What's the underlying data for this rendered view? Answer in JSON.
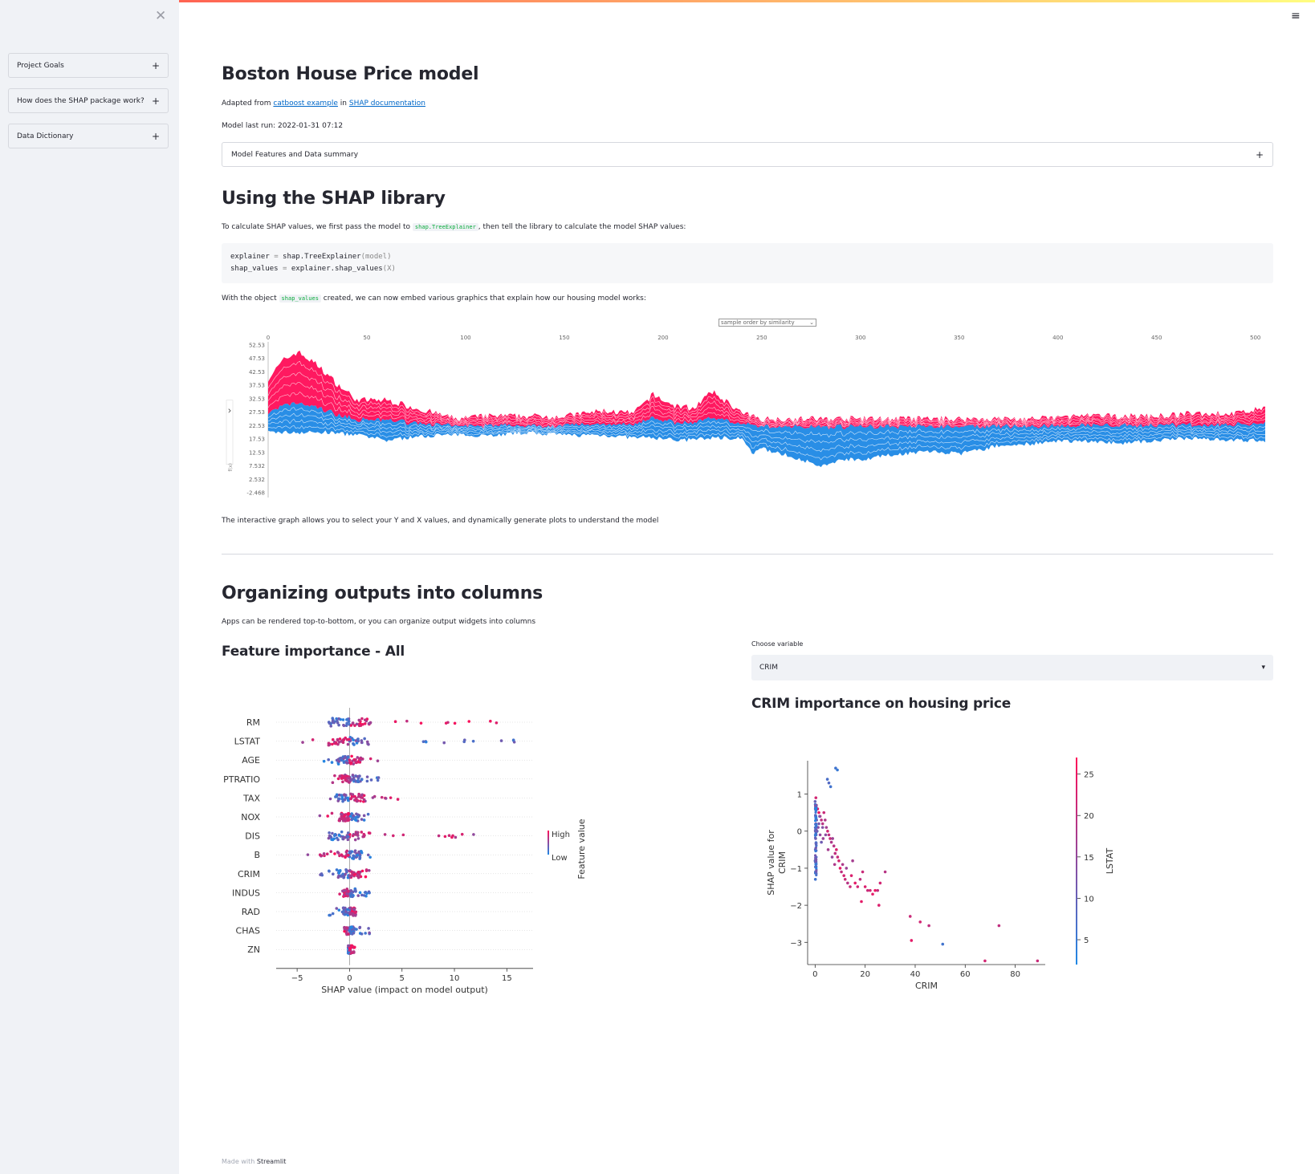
{
  "sidebar": {
    "close_icon": "close-icon",
    "items": [
      {
        "label": "Project Goals",
        "icon": "+"
      },
      {
        "label": "How does the SHAP package work?",
        "icon": "+"
      },
      {
        "label": "Data Dictionary",
        "icon": "+"
      }
    ]
  },
  "menu_icon": "≡",
  "page": {
    "title": "Boston House Price model",
    "adapted_prefix": "Adapted from ",
    "link1": "catboost example",
    "adapted_mid": " in ",
    "link2": "SHAP documentation",
    "last_run": "Model last run: 2022-01-31 07:12",
    "expander_label": "Model Features and Data summary",
    "expander_icon": "+"
  },
  "shap_section": {
    "heading": "Using the SHAP library",
    "intro_before": "To calculate SHAP values, we first pass the model to",
    "intro_code": "shap.TreeExplainer",
    "intro_after": ", then tell the library to calculate the model SHAP values:",
    "code": {
      "line1_a": "explainer",
      "line1_op": " = ",
      "line1_b": "shap.TreeExplainer",
      "line1_c": "(model)",
      "line2_a": "shap_values",
      "line2_op": " = ",
      "line2_b": "explainer.shap_values",
      "line2_c": "(X)"
    },
    "embed_before": "With the object",
    "embed_code": "shap_values",
    "embed_after": "created, we can now embed various graphics that explain how our housing model works:",
    "force_select": "sample order by similarity",
    "force_caption": "The interactive graph allows you to select your Y and X values, and dynamically generate plots to understand the model"
  },
  "columns_section": {
    "heading": "Organizing outputs into columns",
    "subtitle": "Apps can be rendered top-to-bottom, or you can organize output widgets into columns",
    "left_heading": "Feature importance - All",
    "select_label": "Choose variable",
    "select_value": "CRIM",
    "right_heading": "CRIM importance on housing price"
  },
  "footer": {
    "prefix": "Made with ",
    "brand": "Streamlit"
  },
  "colors": {
    "high": "#ff0d57",
    "low": "#1e88e5",
    "accent": "#ff4b4b",
    "link": "#0068c9"
  },
  "chart_data": [
    {
      "type": "area",
      "kind": "shap-force-plot",
      "x_ticks": [
        0,
        50,
        100,
        150,
        200,
        250,
        300,
        350,
        400,
        450,
        500
      ],
      "y_ticks": [
        52.53,
        47.53,
        42.53,
        37.53,
        32.53,
        27.53,
        22.53,
        17.53,
        12.53,
        7.532,
        2.532,
        -2.468
      ],
      "y_tick_labels": [
        "52.53",
        "47.53",
        "42.53",
        "37.53",
        "32.53",
        "27.53",
        "22.53",
        "17.53",
        "12.53",
        "7.532",
        "2.532",
        "-2.468"
      ],
      "xlim": [
        0,
        505
      ],
      "ylim": [
        -2.468,
        52.53
      ],
      "base_value": 22.53,
      "y_label": "f(x)",
      "upper": [
        [
          0,
          40
        ],
        [
          8,
          47
        ],
        [
          15,
          50
        ],
        [
          25,
          45
        ],
        [
          35,
          38
        ],
        [
          45,
          32
        ],
        [
          60,
          32
        ],
        [
          75,
          29
        ],
        [
          85,
          27
        ],
        [
          95,
          25
        ],
        [
          110,
          26
        ],
        [
          130,
          26
        ],
        [
          150,
          26
        ],
        [
          170,
          28
        ],
        [
          185,
          27
        ],
        [
          195,
          34
        ],
        [
          205,
          30
        ],
        [
          215,
          29
        ],
        [
          225,
          35
        ],
        [
          235,
          30
        ],
        [
          240,
          27
        ],
        [
          250,
          25
        ],
        [
          275,
          25
        ],
        [
          290,
          25
        ],
        [
          310,
          25
        ],
        [
          330,
          25
        ],
        [
          350,
          25
        ],
        [
          370,
          25
        ],
        [
          390,
          25
        ],
        [
          410,
          26
        ],
        [
          430,
          26
        ],
        [
          450,
          26
        ],
        [
          470,
          27
        ],
        [
          490,
          27
        ],
        [
          505,
          29
        ]
      ],
      "lower": [
        [
          0,
          20
        ],
        [
          15,
          20
        ],
        [
          30,
          20
        ],
        [
          45,
          19
        ],
        [
          60,
          17
        ],
        [
          70,
          18
        ],
        [
          85,
          19
        ],
        [
          100,
          19
        ],
        [
          115,
          19
        ],
        [
          130,
          20
        ],
        [
          150,
          19
        ],
        [
          170,
          19
        ],
        [
          185,
          18
        ],
        [
          195,
          18
        ],
        [
          210,
          17
        ],
        [
          225,
          18
        ],
        [
          240,
          18
        ],
        [
          245,
          12
        ],
        [
          250,
          14
        ],
        [
          260,
          12
        ],
        [
          270,
          10
        ],
        [
          280,
          7
        ],
        [
          290,
          10
        ],
        [
          300,
          10
        ],
        [
          310,
          11
        ],
        [
          320,
          12
        ],
        [
          335,
          13
        ],
        [
          350,
          12
        ],
        [
          370,
          15
        ],
        [
          390,
          16
        ],
        [
          410,
          17
        ],
        [
          430,
          16
        ],
        [
          450,
          17
        ],
        [
          470,
          18
        ],
        [
          490,
          17
        ],
        [
          505,
          17
        ]
      ]
    },
    {
      "type": "scatter",
      "kind": "shap-beeswarm",
      "features": [
        "RM",
        "LSTAT",
        "AGE",
        "PTRATIO",
        "TAX",
        "NOX",
        "DIS",
        "B",
        "CRIM",
        "INDUS",
        "RAD",
        "CHAS",
        "ZN"
      ],
      "spread": [
        [
          -4,
          16
        ],
        [
          -6,
          16.5
        ],
        [
          -2.5,
          3
        ],
        [
          -1.8,
          3.5
        ],
        [
          -2,
          5
        ],
        [
          -3,
          2
        ],
        [
          -1.5,
          12
        ],
        [
          -4,
          2
        ],
        [
          -3.5,
          2
        ],
        [
          -1,
          2
        ],
        [
          -2,
          1
        ],
        [
          -0.5,
          2
        ],
        [
          -0.2,
          0.5
        ]
      ],
      "x_ticks": [
        -5,
        0,
        5,
        10,
        15
      ],
      "xlim": [
        -7,
        17.5
      ],
      "xlabel": "SHAP value (impact on model output)",
      "colorbar_label": "Feature value",
      "colorbar_high": "High",
      "colorbar_low": "Low"
    },
    {
      "type": "scatter",
      "kind": "shap-dependence",
      "x_ticks": [
        0,
        20,
        40,
        60,
        80
      ],
      "y_ticks": [
        1,
        0,
        -1,
        -2,
        -3
      ],
      "xlim": [
        -3,
        92
      ],
      "ylim": [
        -3.6,
        1.9
      ],
      "xlabel": "CRIM",
      "ylabel_line1": "SHAP value for",
      "ylabel_line2": "CRIM",
      "colorbar_label": "LSTAT",
      "colorbar_ticks": [
        25,
        20,
        15,
        10,
        5
      ],
      "colorbar_range": [
        2,
        27
      ],
      "points": [
        [
          8.2,
          1.7,
          6
        ],
        [
          8.9,
          1.65,
          5
        ],
        [
          4.9,
          1.4,
          7
        ],
        [
          5.5,
          1.3,
          8
        ],
        [
          6.2,
          1.2,
          6
        ],
        [
          0.0,
          0.8,
          10
        ],
        [
          0.1,
          0.6,
          12
        ],
        [
          0.2,
          0.4,
          15
        ],
        [
          0.3,
          0.2,
          18
        ],
        [
          0.1,
          0.0,
          14
        ],
        [
          0.2,
          -0.2,
          12
        ],
        [
          0.1,
          -0.5,
          9
        ],
        [
          0.0,
          -0.8,
          8
        ],
        [
          0.1,
          -1.3,
          6
        ],
        [
          0.3,
          0.9,
          22
        ],
        [
          0.5,
          0.7,
          20
        ],
        [
          1.0,
          0.6,
          24
        ],
        [
          1.5,
          0.5,
          25
        ],
        [
          2.0,
          0.4,
          23
        ],
        [
          2.5,
          0.3,
          20
        ],
        [
          3.0,
          0.2,
          19
        ],
        [
          3.5,
          0.5,
          21
        ],
        [
          4.0,
          0.3,
          18
        ],
        [
          4.5,
          0.1,
          17
        ],
        [
          5.0,
          0.0,
          22
        ],
        [
          5.5,
          -0.1,
          20
        ],
        [
          6.0,
          -0.2,
          21
        ],
        [
          6.5,
          -0.3,
          18
        ],
        [
          7.0,
          -0.2,
          16
        ],
        [
          7.5,
          -0.4,
          19
        ],
        [
          8.0,
          -0.6,
          20
        ],
        [
          8.5,
          -0.5,
          23
        ],
        [
          9.0,
          -0.7,
          21
        ],
        [
          9.5,
          -0.8,
          22
        ],
        [
          10.0,
          -1.0,
          24
        ],
        [
          10.5,
          -1.1,
          20
        ],
        [
          11.0,
          -0.9,
          18
        ],
        [
          11.5,
          -1.2,
          22
        ],
        [
          12.0,
          -1.3,
          21
        ],
        [
          12.5,
          -1.0,
          16
        ],
        [
          13.0,
          -1.4,
          19
        ],
        [
          14.0,
          -1.5,
          21
        ],
        [
          14.5,
          -1.2,
          23
        ],
        [
          15.0,
          -0.8,
          17
        ],
        [
          16.0,
          -1.4,
          24
        ],
        [
          17.0,
          -1.5,
          22
        ],
        [
          18.0,
          -1.3,
          20
        ],
        [
          19.0,
          -1.1,
          21
        ],
        [
          20.0,
          -1.5,
          23
        ],
        [
          21.0,
          -1.6,
          21
        ],
        [
          22.0,
          -1.6,
          22
        ],
        [
          23.0,
          -1.7,
          24
        ],
        [
          24.0,
          -1.6,
          25
        ],
        [
          25.0,
          -1.6,
          20
        ],
        [
          25.5,
          -2.0,
          23
        ],
        [
          26.0,
          -1.4,
          22
        ],
        [
          28.0,
          -1.1,
          19
        ],
        [
          18.5,
          -1.9,
          24
        ],
        [
          38.0,
          -2.3,
          21
        ],
        [
          42.0,
          -2.45,
          22
        ],
        [
          45.5,
          -2.55,
          20
        ],
        [
          38.5,
          -2.95,
          24
        ],
        [
          51.0,
          -3.05,
          6
        ],
        [
          67.9,
          -3.5,
          22
        ],
        [
          73.5,
          -2.55,
          20
        ],
        [
          88.9,
          -3.5,
          21
        ],
        [
          1.5,
          0.2,
          12
        ],
        [
          2.0,
          -0.1,
          15
        ],
        [
          2.5,
          -0.3,
          11
        ],
        [
          3.0,
          0.1,
          13
        ],
        [
          0.4,
          -0.1,
          9
        ],
        [
          0.6,
          0.3,
          11
        ],
        [
          0.8,
          0.0,
          10
        ],
        [
          1.2,
          0.1,
          14
        ],
        [
          1.8,
          0.4,
          13
        ],
        [
          3.2,
          -0.2,
          16
        ],
        [
          4.2,
          -0.1,
          14
        ],
        [
          5.2,
          -0.5,
          17
        ],
        [
          6.8,
          -0.7,
          15
        ],
        [
          7.8,
          -0.9,
          18
        ]
      ]
    }
  ]
}
